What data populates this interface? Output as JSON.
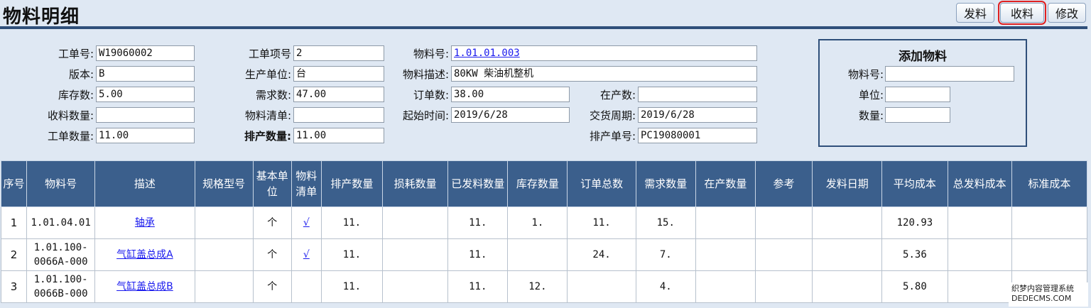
{
  "page_title": "物料明细",
  "toolbar": {
    "issue_label": "发料",
    "receive_label": "收料",
    "edit_label": "修改"
  },
  "form": {
    "work_order_no_label": "工单号:",
    "work_order_no": "W19060002",
    "version_label": "版本:",
    "version": "B",
    "stock_qty_label": "库存数:",
    "stock_qty": "5.00",
    "received_qty_label": "收料数量:",
    "received_qty": "",
    "work_order_qty_label": "工单数量:",
    "work_order_qty": "11.00",
    "work_item_no_label": "工单项号",
    "work_item_no": "2",
    "production_unit_label": "生产单位:",
    "production_unit": "台",
    "demand_qty_label": "需求数:",
    "demand_qty": "47.00",
    "bom_label": "物料清单:",
    "bom": "",
    "scheduled_qty_label": "排产数量:",
    "scheduled_qty": "11.00",
    "material_no_label": "物料号:",
    "material_no": "1.01.01.003",
    "material_desc_label": "物料描述:",
    "material_desc": "80KW 柴油机整机",
    "order_qty_label": "订单数:",
    "order_qty": "38.00",
    "in_production_label": "在产数:",
    "in_production": "",
    "start_time_label": "起始时间:",
    "start_time": "2019/6/28",
    "delivery_label": "交货周期:",
    "delivery": "2019/6/28",
    "schedule_no_label": "排产单号:",
    "schedule_no": "PC19080001"
  },
  "add_material": {
    "title": "添加物料",
    "material_no_label": "物料号:",
    "unit_label": "单位:",
    "qty_label": "数量:"
  },
  "table": {
    "headers": [
      "序号",
      "物料号",
      "描述",
      "规格型号",
      "基本单位",
      "物料清单",
      "排产数量",
      "损耗数量",
      "已发料数量",
      "库存数量",
      "订单总数",
      "需求数量",
      "在产数量",
      "参考",
      "发料日期",
      "平均成本",
      "总发料成本",
      "标准成本"
    ],
    "rows": [
      {
        "seq": "1",
        "material_no": "1.01.04.01",
        "desc": "轴承",
        "spec": "",
        "unit": "个",
        "bom": "√",
        "scheduled": "11.",
        "loss": "",
        "issued": "11.",
        "stock": "1.",
        "order_total": "11.",
        "demand": "15.",
        "in_prod": "",
        "ref": "",
        "issue_date": "",
        "avg_cost": "120.93",
        "total_cost": "",
        "std_cost": ""
      },
      {
        "seq": "2",
        "material_no": "1.01.100-0066A-000",
        "desc": "气缸盖总成A",
        "spec": "",
        "unit": "个",
        "bom": "√",
        "scheduled": "11.",
        "loss": "",
        "issued": "11.",
        "stock": "",
        "order_total": "24.",
        "demand": "7.",
        "in_prod": "",
        "ref": "",
        "issue_date": "",
        "avg_cost": "5.36",
        "total_cost": "",
        "std_cost": ""
      },
      {
        "seq": "3",
        "material_no": "1.01.100-0066B-000",
        "desc": "气缸盖总成B",
        "spec": "",
        "unit": "个",
        "bom": "",
        "scheduled": "11.",
        "loss": "",
        "issued": "11.",
        "stock": "12.",
        "order_total": "",
        "demand": "4.",
        "in_prod": "",
        "ref": "",
        "issue_date": "",
        "avg_cost": "5.80",
        "total_cost": "",
        "std_cost": ""
      }
    ]
  },
  "watermark": {
    "line1": "织梦内容管理系统",
    "line2": "DEDECMS.COM"
  }
}
